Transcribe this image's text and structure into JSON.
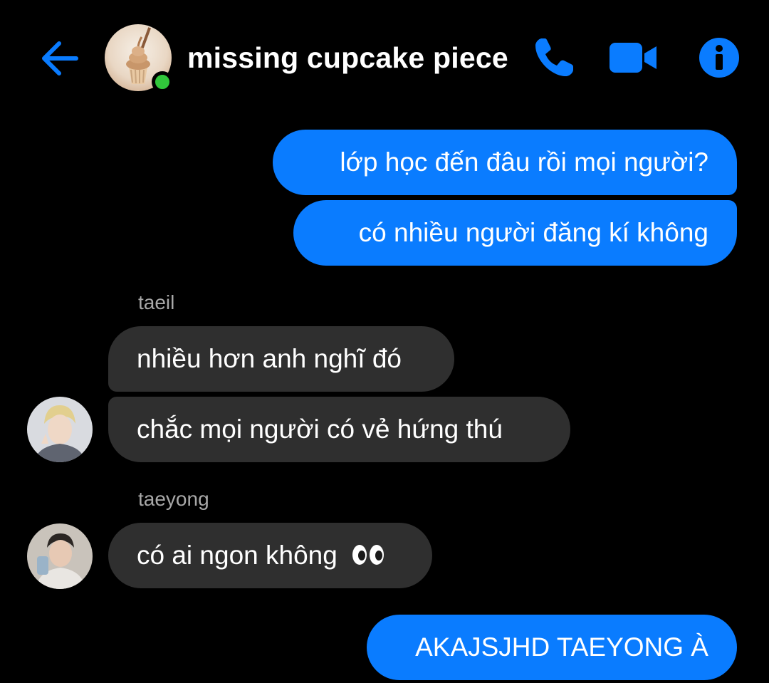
{
  "colors": {
    "background": "#000000",
    "accent": "#0a7cff",
    "outgoing_bubble": "#0a7cff",
    "incoming_bubble": "#2f2f2f",
    "online": "#31c73b",
    "sender_name": "#a8a8a8"
  },
  "header": {
    "back_icon": "arrow-left-icon",
    "chat_title": "missing cupcake piece",
    "avatar_icon": "cupcake-avatar",
    "online_status": "online",
    "phone_icon": "phone-icon",
    "video_icon": "video-camera-icon",
    "info_icon": "info-icon"
  },
  "messages": [
    {
      "direction": "outgoing",
      "text": "lớp học đến đâu rồi mọi người?"
    },
    {
      "direction": "outgoing",
      "text": "có nhiều người đăng kí không"
    },
    {
      "direction": "incoming",
      "sender": "taeil",
      "text": "nhiều hơn anh nghĩ đó"
    },
    {
      "direction": "incoming",
      "sender": "taeil",
      "text": "chắc mọi người có vẻ hứng thú"
    },
    {
      "direction": "incoming",
      "sender": "taeyong",
      "text": "có ai ngon không",
      "emoji": "eyes-emoji"
    },
    {
      "direction": "outgoing",
      "text": "AKAJSJHD TAEYONG À"
    }
  ]
}
